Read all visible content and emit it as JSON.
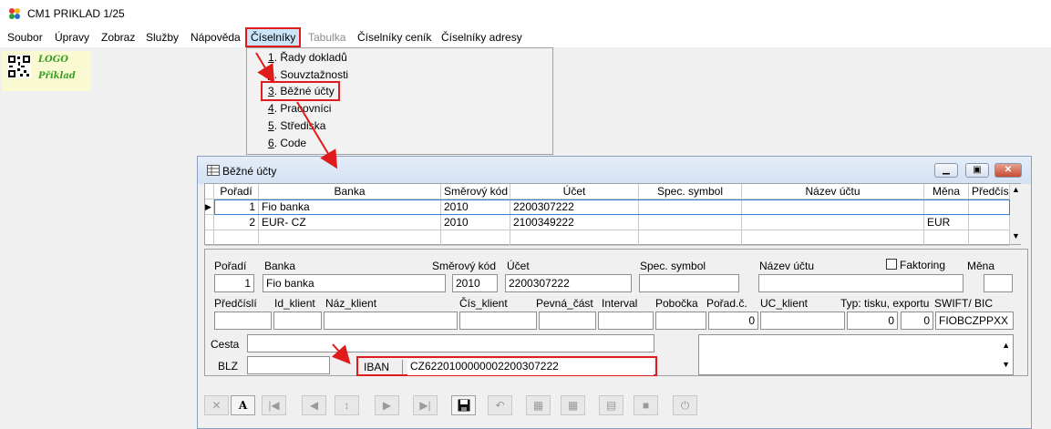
{
  "app": {
    "title": "CM1 PRIKLAD 1/25"
  },
  "menubar": [
    "Soubor",
    "Úpravy",
    "Zobraz",
    "Služby",
    "Nápověda",
    "Číselníky",
    "Tabulka",
    "Číselníky ceník",
    "Číselníky adresy"
  ],
  "logo": {
    "line1": "LOGO",
    "line2": "Příklad"
  },
  "dropdown": {
    "items": [
      {
        "num": "1",
        "label": ". Řady dokladů"
      },
      {
        "num": "2",
        "label": ". Souvztažnosti"
      },
      {
        "num": "3",
        "label": ". Běžné účty"
      },
      {
        "num": "4",
        "label": ". Pracovníci"
      },
      {
        "num": "5",
        "label": ". Střediska"
      },
      {
        "num": "6",
        "label": ". Code"
      }
    ]
  },
  "window": {
    "title": "Běžné účty"
  },
  "grid": {
    "headers": [
      "Pořadí",
      "Banka",
      "Směrový kód",
      "Účet",
      "Spec. symbol",
      "Název účtu",
      "Měna",
      "Předčís"
    ],
    "rows": [
      [
        "1",
        "Fio banka",
        "2010",
        "2200307222",
        "",
        "",
        "",
        ""
      ],
      [
        "2",
        "EUR- CZ",
        "2010",
        "2100349222",
        "",
        "",
        "EUR",
        ""
      ]
    ]
  },
  "form": {
    "labels": {
      "poradi": "Pořadí",
      "banka": "Banka",
      "smerovy_kod": "Směrový kód",
      "ucet": "Účet",
      "spec_symbol": "Spec. symbol",
      "nazev_uctu": "Název účtu",
      "faktoring": "Faktoring",
      "mena": "Měna",
      "predcisli": "Předčíslí",
      "id_klient": "Id_klient",
      "naz_klient": "Náz_klient",
      "cis_klient": "Čís_klient",
      "pevna_cast": "Pevná_část",
      "interval": "Interval",
      "pobocka": "Pobočka",
      "porad_c": "Pořad.č.",
      "uc_klient": "UC_klient",
      "typ_tisku": "Typ: tisku, exportu",
      "swift": "SWIFT/ BIC",
      "cesta": "Cesta",
      "blz": "BLZ",
      "iban": "IBAN"
    },
    "values": {
      "poradi": "1",
      "banka": "Fio banka",
      "smerovy_kod": "2010",
      "ucet": "2200307222",
      "spec_symbol": "",
      "nazev_uctu": "",
      "mena": "",
      "predcisli": "",
      "id_klient": "",
      "naz_klient": "",
      "cis_klient": "",
      "pevna_cast": "",
      "interval": "",
      "pobocka": "",
      "porad_c": "0",
      "uc_klient": "",
      "typ_tisku": "0",
      "typ_exportu": "0",
      "swift": "FIOBCZPPXX",
      "cesta": "",
      "blz": "",
      "iban": "CZ6220100000002200307222"
    },
    "faktoring_checked": false
  },
  "toolbar": {
    "buttons": [
      {
        "name": "cancel-tool-button",
        "icon": "✕",
        "enabled": false
      },
      {
        "name": "font-tool-button",
        "icon": "A",
        "enabled": true
      },
      {
        "name": "first-record-button",
        "icon": "|◀",
        "enabled": false
      },
      {
        "name": "prev-record-button",
        "icon": "◀",
        "enabled": false
      },
      {
        "name": "sort-button",
        "icon": "↕",
        "enabled": false
      },
      {
        "name": "next-record-button",
        "icon": "▶",
        "enabled": false
      },
      {
        "name": "last-record-button",
        "icon": "▶|",
        "enabled": false
      },
      {
        "name": "save-button",
        "icon": "💾",
        "enabled": true
      },
      {
        "name": "undo-button",
        "icon": "↶",
        "enabled": false
      },
      {
        "name": "copy-record-button",
        "icon": "▦",
        "enabled": false
      },
      {
        "name": "paste-record-button",
        "icon": "▦",
        "enabled": false
      },
      {
        "name": "print-button",
        "icon": "▤",
        "enabled": false
      },
      {
        "name": "stop-button",
        "icon": "■",
        "enabled": false
      },
      {
        "name": "power-button",
        "icon": "⏻",
        "enabled": false
      }
    ]
  },
  "colors": {
    "highlight_red": "#e01b1b",
    "logo_green": "#3a9d23",
    "logo_bg": "#fafad2"
  }
}
